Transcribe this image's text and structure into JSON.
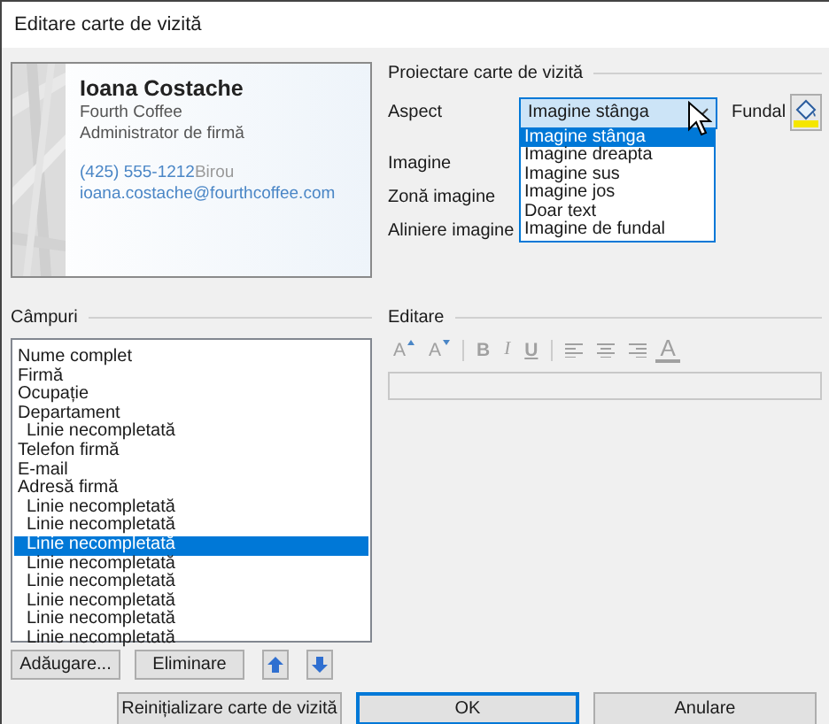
{
  "window": {
    "title": "Editare carte de vizită"
  },
  "card_preview": {
    "name": "Ioana Costache",
    "company": "Fourth Coffee",
    "job_title": "Administrator de firmă",
    "phone": "(425) 555-1212",
    "phone_label": "Birou",
    "email": "ioana.costache@fourthcoffee.com"
  },
  "design": {
    "heading": "Proiectare carte de vizită",
    "layout_label": "Aspect",
    "layout_value": "Imagine stânga",
    "expanded": true,
    "layout_options": [
      {
        "label": "Imagine stânga",
        "selected": true
      },
      {
        "label": "Imagine dreapta",
        "selected": false
      },
      {
        "label": "Imagine sus",
        "selected": false
      },
      {
        "label": "Imagine jos",
        "selected": false
      },
      {
        "label": "Doar text",
        "selected": false
      },
      {
        "label": "Imagine de fundal",
        "selected": false
      }
    ],
    "background_label": "Fundal",
    "image_label": "Imagine",
    "image_area_label": "Zonă imagine",
    "image_align_label": "Aliniere imagine"
  },
  "fields": {
    "heading": "Câmpuri",
    "items": [
      {
        "label": "Nume complet",
        "selected": false
      },
      {
        "label": "Firmă",
        "selected": false
      },
      {
        "label": "Ocupație",
        "selected": false
      },
      {
        "label": "Departament",
        "selected": false,
        "children": [
          {
            "label": "Linie necompletată",
            "selected": false
          }
        ]
      },
      {
        "label": "Telefon firmă",
        "selected": false
      },
      {
        "label": "E-mail",
        "selected": false
      },
      {
        "label": "Adresă firmă",
        "selected": false,
        "children": [
          {
            "label": "Linie necompletată",
            "selected": false
          },
          {
            "label": "Linie necompletată",
            "selected": false
          },
          {
            "label": "Linie necompletată",
            "selected": true
          },
          {
            "label": "Linie necompletată",
            "selected": false
          },
          {
            "label": "Linie necompletată",
            "selected": false
          },
          {
            "label": "Linie necompletată",
            "selected": false
          },
          {
            "label": "Linie necompletată",
            "selected": false
          },
          {
            "label": "Linie necompletată",
            "selected": false
          }
        ]
      }
    ],
    "buttons": [
      {
        "kind": "text",
        "label": "Adăugare..."
      },
      {
        "kind": "text",
        "label": "Eliminare"
      },
      {
        "kind": "up"
      },
      {
        "kind": "down"
      }
    ]
  },
  "editor": {
    "heading": "Editare",
    "toolbar": [
      {
        "kind": "grow",
        "label": "A",
        "disabled": true
      },
      {
        "kind": "shrink",
        "label": "A",
        "disabled": true
      },
      {
        "kind": "bold",
        "label": "B",
        "disabled": true
      },
      {
        "kind": "italic",
        "label": "I",
        "disabled": true
      },
      {
        "kind": "underline",
        "label": "U",
        "disabled": true
      },
      {
        "kind": "align-left",
        "disabled": true
      },
      {
        "kind": "align-center",
        "disabled": true
      },
      {
        "kind": "align-right",
        "disabled": true
      },
      {
        "kind": "font-color",
        "label": "A",
        "disabled": true
      }
    ]
  },
  "buttons": [
    {
      "label": "Reinițializare carte de vizită",
      "focused": false
    },
    {
      "label": "OK",
      "focused": true
    },
    {
      "label": "Anulare",
      "focused": false
    }
  ]
}
